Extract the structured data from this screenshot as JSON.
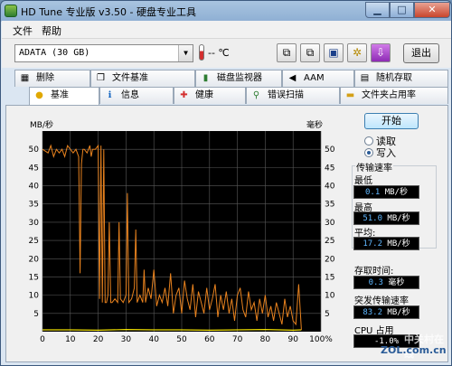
{
  "window": {
    "title": "HD Tune 专业版 v3.50 - 硬盘专业工具"
  },
  "menu": {
    "file": "文件",
    "help": "帮助"
  },
  "toolbar": {
    "drive": "ADATA (30 GB)",
    "temperature": "-- ℃",
    "exit_label": "退出",
    "icons": [
      "copy-icon",
      "copy-all-icon",
      "save-icon",
      "options-icon",
      "screenshot-icon"
    ]
  },
  "tabs_top": [
    {
      "label": "删除",
      "icon": "erase-icon"
    },
    {
      "label": "文件基准",
      "icon": "file-benchmark-icon"
    },
    {
      "label": "磁盘监视器",
      "icon": "disk-monitor-icon"
    },
    {
      "label": "AAM",
      "icon": "speaker-icon"
    },
    {
      "label": "随机存取",
      "icon": "random-access-icon"
    }
  ],
  "tabs_bottom": [
    {
      "label": "基准",
      "icon": "bulb-icon",
      "active": true
    },
    {
      "label": "信息",
      "icon": "info-icon"
    },
    {
      "label": "健康",
      "icon": "health-icon"
    },
    {
      "label": "错误扫描",
      "icon": "magnifier-icon"
    },
    {
      "label": "文件夹占用率",
      "icon": "folder-icon"
    }
  ],
  "controls": {
    "start": "开始",
    "read": "读取",
    "write": "写入",
    "selected_mode": "write"
  },
  "stats": {
    "group_title": "传输速率",
    "min_label": "最低",
    "min_value": "0.1",
    "min_unit": "MB/秒",
    "max_label": "最高",
    "max_value": "51.0",
    "max_unit": "MB/秒",
    "avg_label": "平均:",
    "avg_value": "17.2",
    "avg_unit": "MB/秒",
    "access_label": "存取时间:",
    "access_value": "0.3",
    "access_unit": "毫秒",
    "burst_label": "突发传输速率",
    "burst_value": "83.2",
    "burst_unit": "MB/秒",
    "cpu_label": "CPU 占用",
    "cpu_value": "-1.0%"
  },
  "watermark": {
    "text": "中关村在线",
    "sub": "ZOL.com.cn"
  },
  "chart_data": {
    "type": "line",
    "y_left_label": "MB/秒",
    "y_right_label": "毫秒",
    "xlim": [
      0,
      100
    ],
    "ylim": [
      0,
      55
    ],
    "x_ticks": [
      "0",
      "10",
      "20",
      "30",
      "40",
      "50",
      "60",
      "70",
      "80",
      "90",
      "100%"
    ],
    "y_ticks_left": [
      "5",
      "10",
      "15",
      "20",
      "25",
      "30",
      "35",
      "40",
      "45",
      "50"
    ],
    "y_ticks_right": [
      "5",
      "10",
      "15",
      "20",
      "25",
      "30",
      "35",
      "40",
      "45",
      "50"
    ],
    "grid": true,
    "colors": {
      "transfer": "#e8821e",
      "access": "#f0e000",
      "grid": "#5a5a5a",
      "background": "#000000"
    },
    "series": [
      {
        "x": [
          0,
          2,
          3,
          4,
          5,
          6,
          7,
          8,
          9,
          10,
          11,
          12,
          13,
          13.5,
          14,
          14.5,
          15,
          16,
          17,
          17.5,
          18,
          19,
          20,
          20.5,
          21,
          21.5,
          22,
          22.5,
          23,
          23.5,
          24,
          24.5,
          25,
          26,
          27,
          27.5,
          28,
          29,
          30,
          30.5,
          31,
          32,
          33,
          33.5,
          34,
          35,
          36,
          36.5,
          37,
          38,
          39,
          40,
          41,
          42,
          43,
          44,
          45,
          46,
          47,
          48,
          49,
          50,
          51,
          52,
          53,
          54,
          55,
          56,
          57,
          58,
          59,
          60,
          61,
          62,
          63,
          64,
          65,
          66,
          67,
          68,
          69,
          70,
          71,
          72,
          73,
          74,
          75,
          76,
          77,
          78,
          79,
          80,
          81,
          82,
          83,
          84,
          85,
          86,
          87,
          88,
          89,
          90,
          91,
          92,
          93
        ],
        "y": [
          50,
          49,
          51,
          48,
          50,
          49,
          50,
          48,
          51,
          50,
          49,
          50,
          48,
          16,
          46,
          50,
          50,
          49,
          51,
          48,
          50,
          50,
          51,
          9,
          51,
          8,
          50,
          8,
          8,
          10,
          30,
          8,
          8,
          9,
          8,
          30,
          9,
          8,
          10,
          38,
          8,
          9,
          12,
          28,
          8,
          10,
          8,
          17,
          8,
          12,
          9,
          17,
          7,
          10,
          8,
          12,
          7,
          16,
          5,
          10,
          12,
          5,
          14,
          9,
          6,
          13,
          4,
          11,
          8,
          5,
          12,
          6,
          9,
          13,
          4,
          10,
          6,
          11,
          5,
          9,
          3,
          10,
          12,
          6,
          4,
          11,
          6,
          8,
          3,
          9,
          5,
          10,
          4,
          7,
          3,
          8,
          5,
          2,
          9,
          4,
          7,
          3,
          2,
          13,
          0.5
        ]
      },
      {
        "x": [
          0,
          10,
          20,
          30,
          40,
          50,
          60,
          70,
          80,
          90,
          93
        ],
        "y": [
          0.5,
          0.5,
          0.4,
          0.6,
          0.5,
          0.5,
          0.4,
          0.5,
          0.6,
          0.4,
          0.5
        ]
      }
    ]
  }
}
